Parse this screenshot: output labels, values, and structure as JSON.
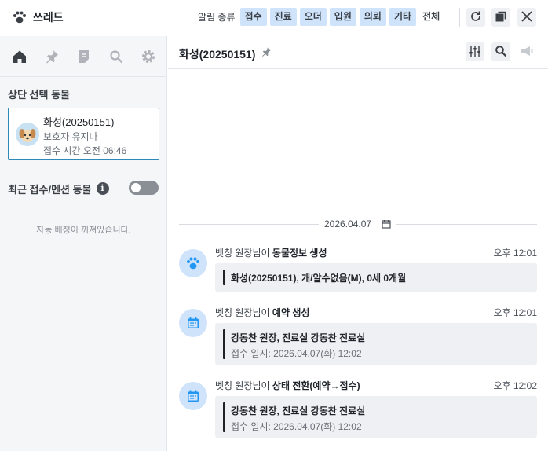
{
  "app": {
    "name": "쓰레드"
  },
  "filters": {
    "label": "알림 종류",
    "chips": [
      "접수",
      "진료",
      "오더",
      "입원",
      "의뢰",
      "기타"
    ],
    "all": "전체"
  },
  "sidebar": {
    "selected_title": "상단 선택 동물",
    "animal": {
      "name": "화성(20250151)",
      "owner": "보호자 유지나",
      "time": "접수 시간 오전 06:46"
    },
    "recent_title": "최근 접수/멘션 동물",
    "info_icon": "i",
    "auto_message": "자동 배정이 꺼져있습니다."
  },
  "main": {
    "title": "화성(20250151)",
    "date": "2026.04.07",
    "events": [
      {
        "actor": "벳칭 원장님이",
        "action": "동물정보 생성",
        "time": "오후 12:01",
        "main": "화성(20250151), 개/알수없음(M), 0세 0개월",
        "sub": "",
        "icon": "paw-icon"
      },
      {
        "actor": "벳칭 원장님이",
        "action": "예약 생성",
        "time": "오후 12:01",
        "main": "강동찬 원장, 진료실 강동찬 진료실",
        "sub": "접수 일시: 2026.04.07(화) 12:02",
        "icon": "calendar-icon"
      },
      {
        "actor": "벳칭 원장님이",
        "action": "상태 전환(예약→접수)",
        "time": "오후 12:02",
        "main": "강동찬 원장, 진료실 강동찬 진료실",
        "sub": "접수 일시: 2026.04.07(화) 12:02",
        "icon": "calendar-icon"
      }
    ]
  },
  "colors": {
    "accent": "#2196f3",
    "chip_bg": "#cfe3fb",
    "card_border": "#2b8ab8"
  }
}
